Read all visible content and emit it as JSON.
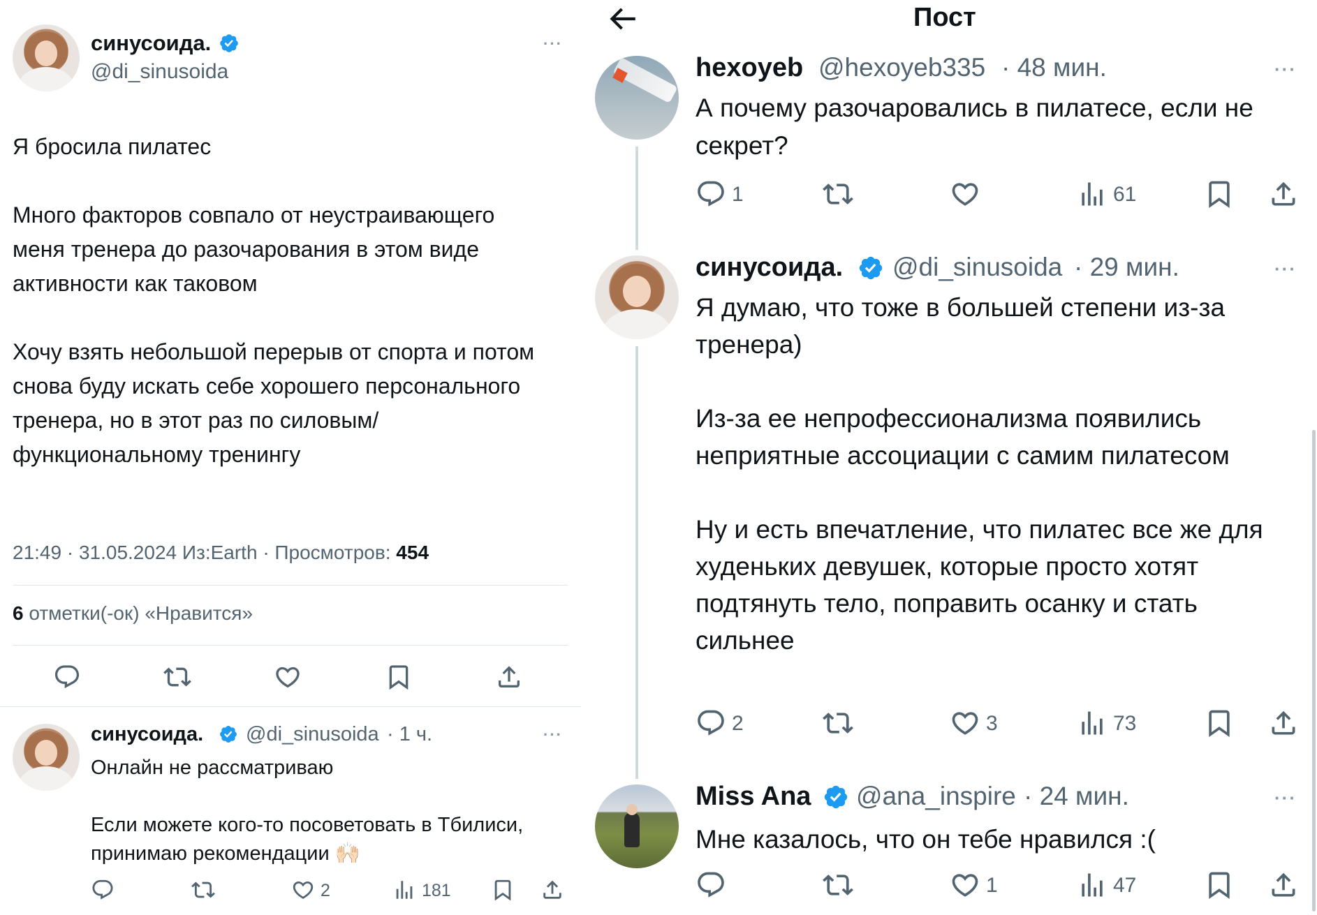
{
  "left": {
    "author": {
      "name": "синусоида.",
      "handle": "@di_sinusoida"
    },
    "post": {
      "text": "Я бросила пилатес\n\nМного факторов совпало от неустраивающего меня тренера до разочарования в этом виде активности как таковом\n\nХочу взять небольшой перерыв от спорта и потом снова буду искать себе хорошего персонального тренера, но в этот раз по силовым/функциональному тренингу",
      "meta_prefix": "21:49 · 31.05.2024 Из:Earth · Просмотров:",
      "views": "454",
      "likes_count": "6",
      "likes_label": "отметки(-ок) «Нравится»"
    },
    "reply": {
      "name": "синусоида.",
      "handle": "@di_sinusoida",
      "time": "· 1 ч.",
      "text": "Онлайн не рассматриваю\n\nЕсли можете кого-то посоветовать в Тбилиси, принимаю рекомендации 🙌🏻",
      "likes": "2",
      "views": "181"
    }
  },
  "right": {
    "header": {
      "title": "Пост",
      "back_icon": "arrow-left-icon"
    },
    "replies": [
      {
        "name": "hexoyeb",
        "handle": "@hexoyeb335",
        "time": "· 48 мин.",
        "text": "А почему разочаровались в пилатесе, если не секрет?",
        "replies": "1",
        "likes": "",
        "views": "61"
      },
      {
        "name": "синусоида.",
        "handle": "@di_sinusoida",
        "time": "· 29 мин.",
        "text": "Я думаю, что тоже в большей степени из-за тренера)\n\nИз-за ее непрофессионализма появились неприятные ассоциации с самим пилатесом\n\nНу и есть впечатление, что пилатес все же для худеньких девушек, которые просто хотят подтянуть тело, поправить осанку и стать сильнее",
        "replies": "2",
        "likes": "3",
        "views": "73"
      },
      {
        "name": "Miss Ana",
        "handle": "@ana_inspire",
        "time": "· 24 мин.",
        "text": "Мне казалось, что он тебе нравился :(",
        "replies": "",
        "likes": "1",
        "views": "47"
      }
    ]
  },
  "colors": {
    "verified": "#1d9bf0",
    "secondary": "#536471",
    "divider": "#e1e8ed"
  }
}
